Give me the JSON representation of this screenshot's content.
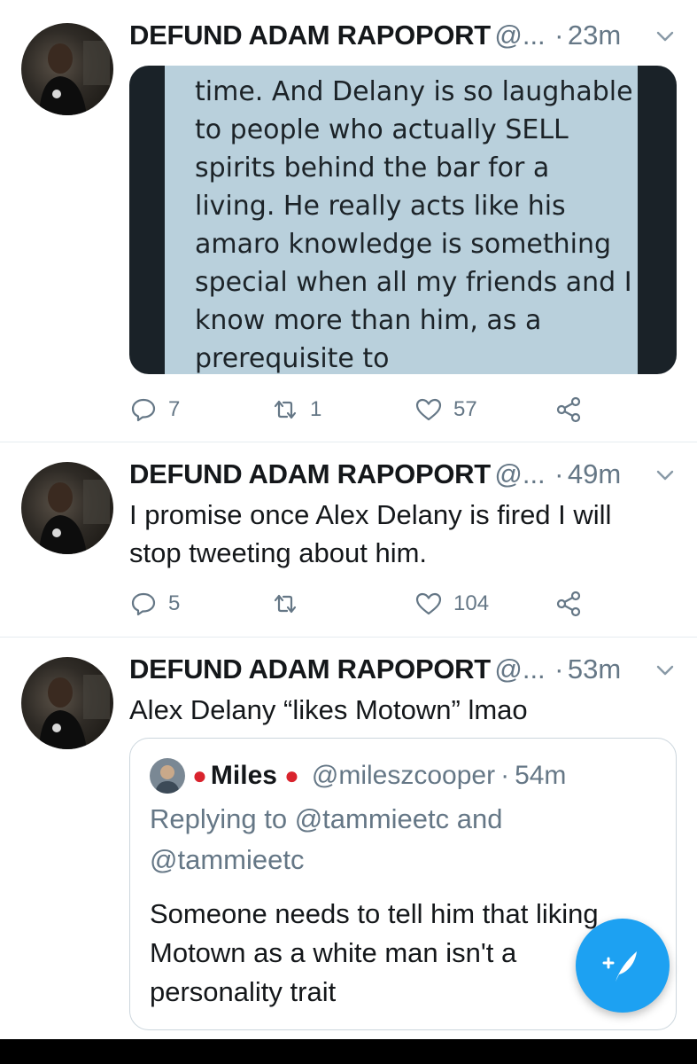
{
  "tweets": [
    {
      "name": "DEFUND ADAM RAPOPORT",
      "handle": "@...",
      "time": "23m",
      "media_text": "time. And Delany is so laughable to people who actually SELL spirits behind the bar for a living. He really acts like his amaro knowledge is something special when all my friends and I know more than him, as a prerequisite to",
      "replies": "7",
      "retweets": "1",
      "likes": "57"
    },
    {
      "name": "DEFUND ADAM RAPOPORT",
      "handle": "@...",
      "time": "49m",
      "text": "I promise once Alex Delany is fired I will stop tweeting about him.",
      "replies": "5",
      "retweets": "",
      "likes": "104"
    },
    {
      "name": "DEFUND ADAM RAPOPORT",
      "handle": "@...",
      "time": "53m",
      "text": "Alex Delany “likes Motown” lmao",
      "quote": {
        "name": "Miles",
        "handle": "@mileszcooper",
        "time": "54m",
        "reply_line": "Replying to @tammieetc and @tammieetc",
        "text": "Someone needs to tell him that liking Motown as a white man isn't a personality trait"
      }
    }
  ],
  "separator": "·",
  "icons": {
    "reply": "reply-icon",
    "retweet": "retweet-icon",
    "like": "heart-icon",
    "share": "share-icon",
    "caret": "chevron-down-icon",
    "compose": "compose-tweet-icon"
  },
  "colors": {
    "accent": "#1da1f2",
    "secondary_text": "#657786",
    "primary_text": "#14171a"
  }
}
